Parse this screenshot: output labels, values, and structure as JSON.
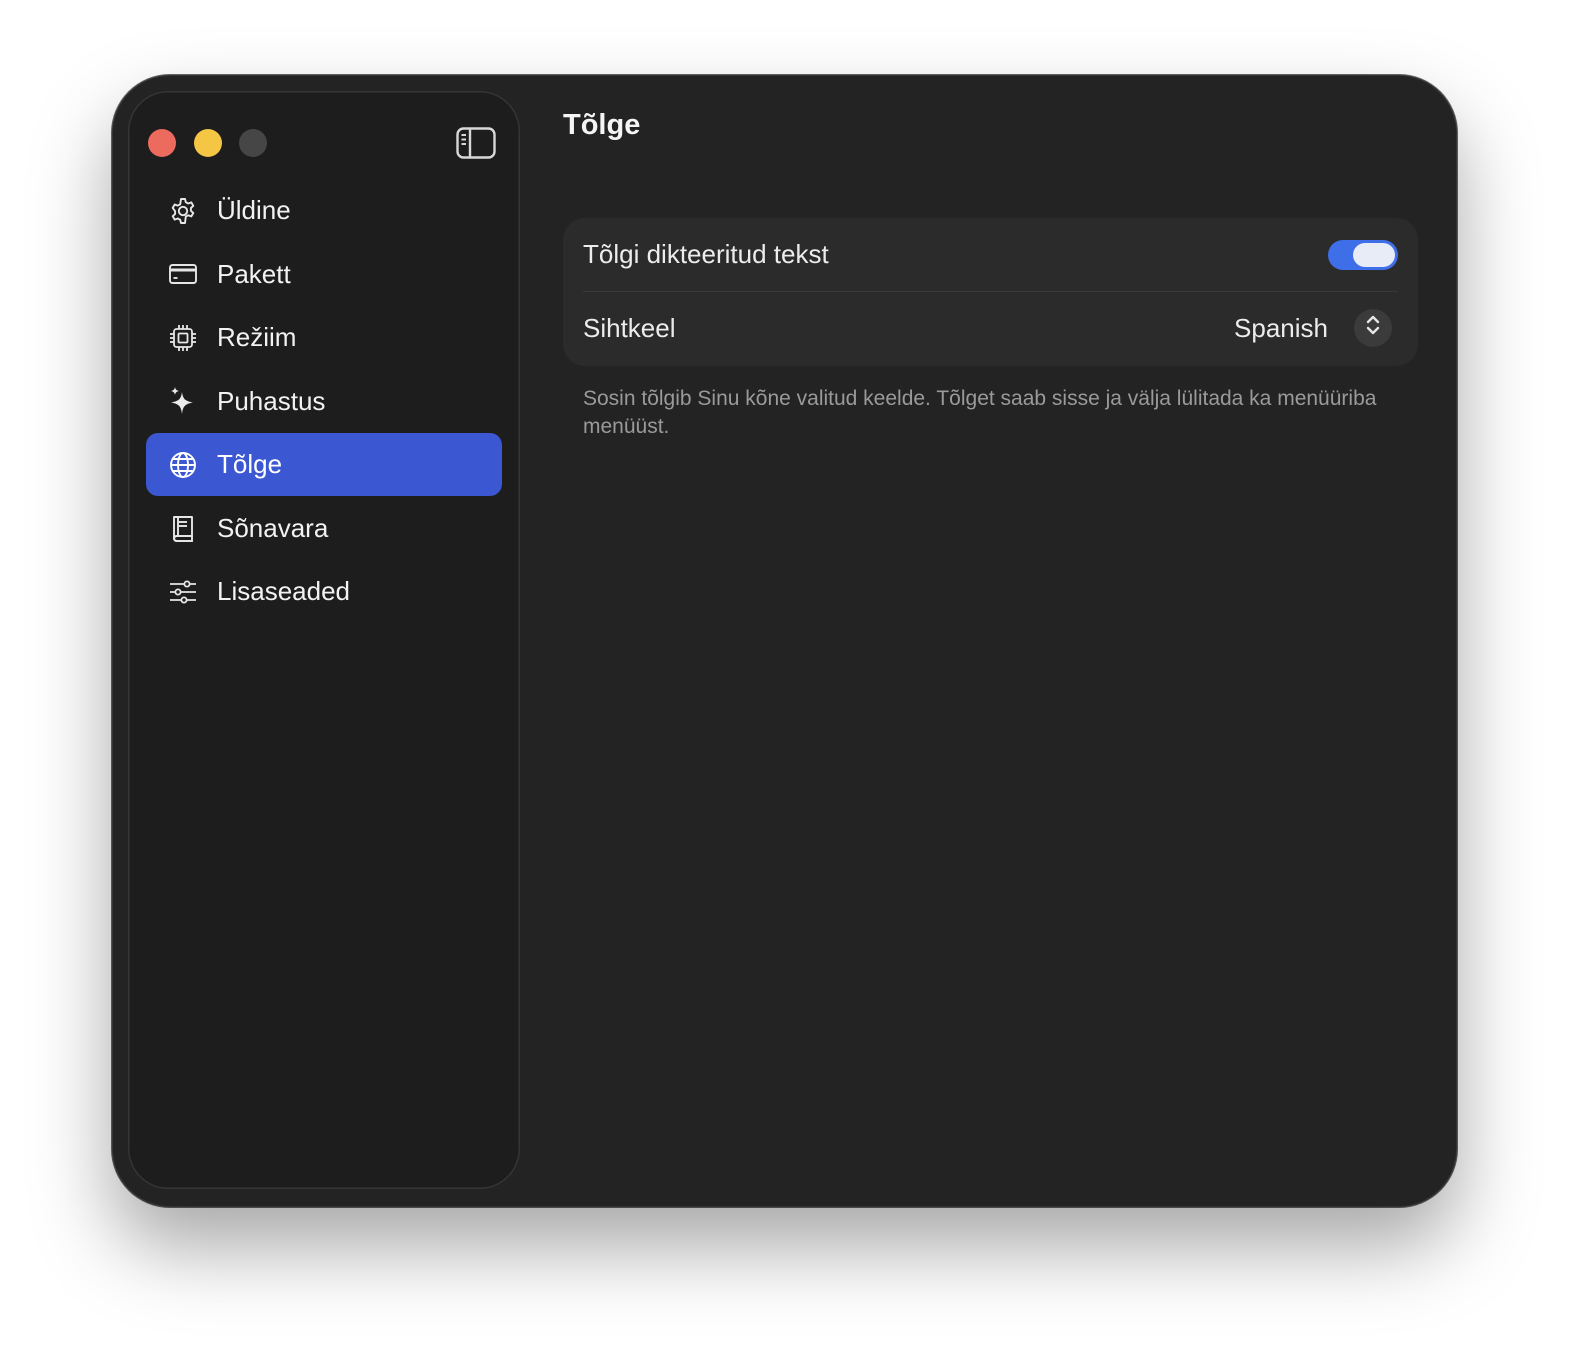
{
  "sidebar": {
    "items": [
      {
        "label": "Üldine",
        "icon": "gear-icon",
        "active": false
      },
      {
        "label": "Pakett",
        "icon": "credit-card-icon",
        "active": false
      },
      {
        "label": "Režiim",
        "icon": "cpu-chip-icon",
        "active": false
      },
      {
        "label": "Puhastus",
        "icon": "sparkles-icon",
        "active": false
      },
      {
        "label": "Tõlge",
        "icon": "globe-icon",
        "active": true
      },
      {
        "label": "Sõnavara",
        "icon": "book-icon",
        "active": false
      },
      {
        "label": "Lisaseaded",
        "icon": "sliders-icon",
        "active": false
      }
    ]
  },
  "main": {
    "title": "Tõlge",
    "settings": {
      "translate_label": "Tõlgi dikteeritud tekst",
      "translate_enabled": true,
      "target_language_label": "Sihtkeel",
      "target_language_value": "Spanish"
    },
    "description": "Sosin tõlgib Sinu kõne valitud keelde. Tõlget saab sisse ja välja lülitada ka menüüriba menüüst."
  },
  "colors": {
    "accent": "#3b57d1",
    "toggle_on": "#3e6ee8",
    "window_bg": "#232323",
    "sidebar_bg": "#1d1d1d",
    "close": "#ed6a5e",
    "minimize": "#f5c544",
    "zoom_disabled": "#464646"
  }
}
